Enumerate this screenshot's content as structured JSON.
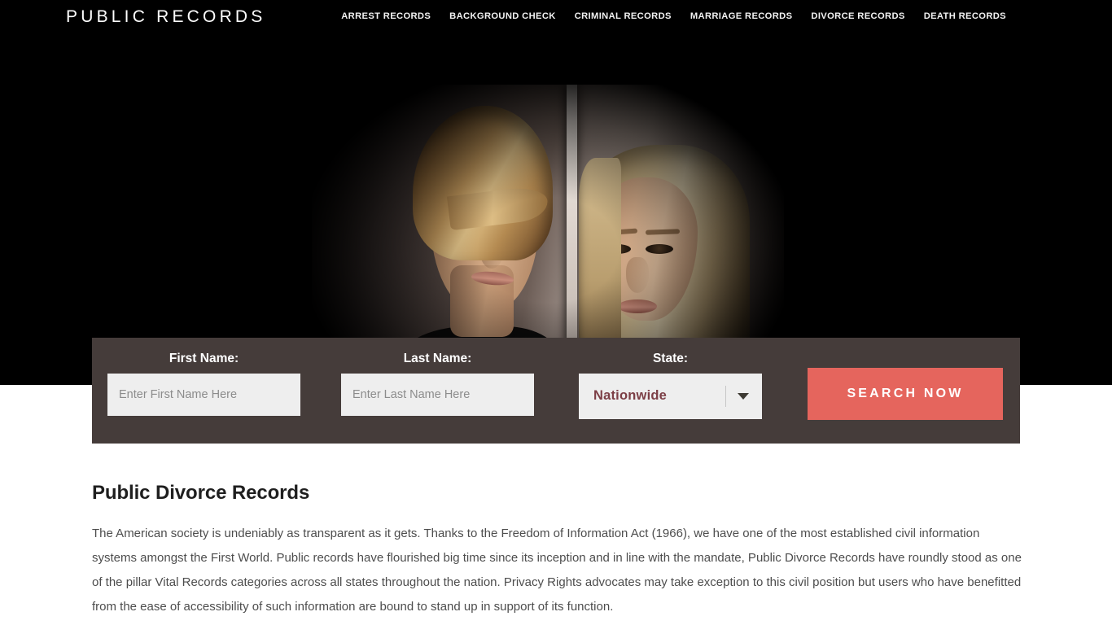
{
  "header": {
    "brand": "PUBLIC RECORDS",
    "nav": [
      {
        "label": "ARREST RECORDS"
      },
      {
        "label": "BACKGROUND CHECK"
      },
      {
        "label": "CRIMINAL RECORDS"
      },
      {
        "label": "MARRIAGE RECORDS"
      },
      {
        "label": "DIVORCE RECORDS"
      },
      {
        "label": "DEATH RECORDS"
      }
    ]
  },
  "hero": {
    "image_alt": "Couple separated by a wall, man on the left with eyes closed and woman on the right looking down"
  },
  "search_form": {
    "first_name": {
      "label": "First Name:",
      "placeholder": "Enter First Name Here",
      "value": ""
    },
    "last_name": {
      "label": "Last Name:",
      "placeholder": "Enter Last Name Here",
      "value": ""
    },
    "state": {
      "label": "State:",
      "selected": "Nationwide",
      "icon": "chevron-down-icon"
    },
    "submit": {
      "label": "SEARCH NOW"
    }
  },
  "article": {
    "title": "Public Divorce Records",
    "body": "The American society is undeniably as transparent as it gets. Thanks to the Freedom of Information Act (1966), we have one of the most established civil information systems amongst the First World. Public records have flourished big time since its inception and in line with the mandate, Public Divorce Records have roundly stood as one of the pillar Vital Records categories across all states throughout the nation. Privacy Rights advocates may take exception to this civil position but users who have benefitted from the ease of accessibility of such information are bound to stand up in support of its function."
  },
  "colors": {
    "header_bg": "#000000",
    "hero_bg": "#000000",
    "form_bar_bg": "#453c3a",
    "input_bg": "#eeeeee",
    "accent_button": "#e5655d",
    "select_value_text": "#7c3f46",
    "page_bg": "#ffffff",
    "body_text": "#4d4d4d"
  }
}
